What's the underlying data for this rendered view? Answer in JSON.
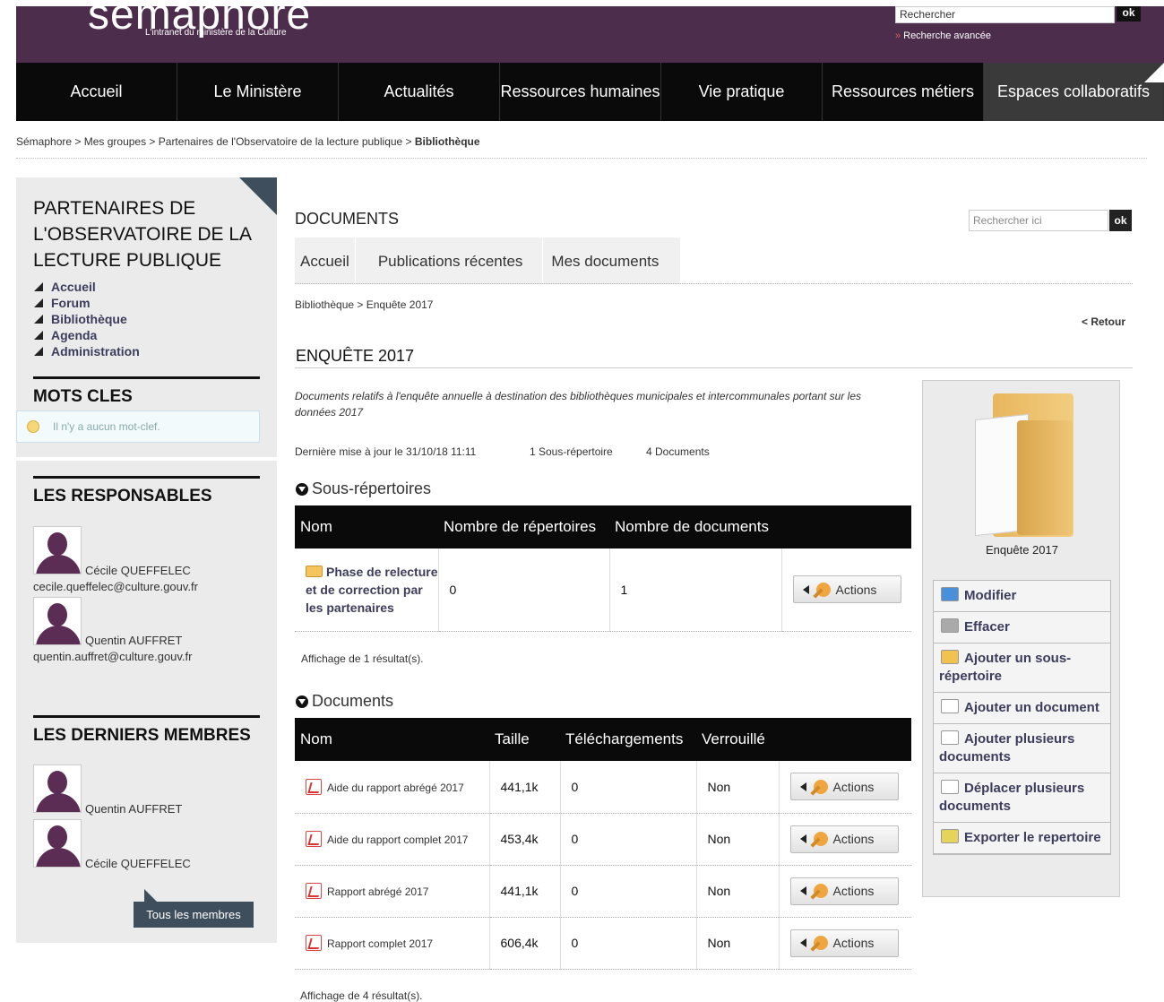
{
  "header": {
    "logo_word": "sémaphore",
    "logo_tagline": "L'intranet du ministère de la Culture",
    "search_placeholder": "Rechercher",
    "search_ok": "ok",
    "advanced_search": "Recherche avancée"
  },
  "nav": [
    {
      "label": "Accueil",
      "width": 180
    },
    {
      "label": "Le Ministère",
      "width": 180
    },
    {
      "label": "Actualités",
      "width": 180
    },
    {
      "label": "Ressources humaines",
      "width": 180
    },
    {
      "label": "Vie pratique",
      "width": 180
    },
    {
      "label": "Ressources métiers",
      "width": 180
    },
    {
      "label": "Espaces collaboratifs",
      "width": 201
    }
  ],
  "breadcrumb": {
    "trail": "Sémaphore > Mes groupes > Partenaires de l'Observatoire de la lecture publique > ",
    "current": "Bibliothèque"
  },
  "group": {
    "title": "PARTENAIRES DE L'OBSERVATOIRE DE LA LECTURE PUBLIQUE",
    "menu": [
      "Accueil",
      "Forum",
      "Bibliothèque",
      "Agenda",
      "Administration"
    ]
  },
  "keywords": {
    "heading": "MOTS CLES",
    "empty": "Il n'y a aucun mot-clef."
  },
  "responsables": {
    "heading": "LES RESPONSABLES",
    "people": [
      {
        "name": "Cécile QUEFFELEC",
        "email": "cecile.queffelec@culture.gouv.fr"
      },
      {
        "name": "Quentin AUFFRET",
        "email": "quentin.auffret@culture.gouv.fr"
      }
    ]
  },
  "members": {
    "heading": "LES DERNIERS MEMBRES",
    "people": [
      "Quentin AUFFRET",
      "Cécile QUEFFELEC"
    ],
    "all_button": "Tous les membres"
  },
  "documents": {
    "heading": "DOCUMENTS",
    "search_placeholder": "Rechercher ici",
    "search_ok": "ok",
    "tabs": [
      "Accueil",
      "Publications récentes",
      "Mes documents"
    ],
    "sub_breadcrumb_trail": "Bibliothèque > ",
    "sub_breadcrumb_current": "Enquête 2017",
    "back": "< Retour"
  },
  "folder": {
    "title": "ENQUÊTE 2017",
    "description": "Documents relatifs à l'enquête annuelle à destination des bibliothèques municipales et intercommunales portant sur les données 2017",
    "last_update": "Dernière mise à jour le 31/10/18 11:11",
    "subfolder_count": "1 Sous-répertoire",
    "doc_count": "4 Documents"
  },
  "subfolders": {
    "heading": "Sous-répertoires",
    "columns": [
      "Nom",
      "Nombre de répertoires",
      "Nombre de documents",
      ""
    ],
    "rows": [
      {
        "name": "Phase de relecture et de correction par les partenaires",
        "dirs": "0",
        "docs": "1",
        "action": "Actions"
      }
    ],
    "result": "Affichage de 1 résultat(s)."
  },
  "files": {
    "heading": "Documents",
    "columns": [
      "Nom",
      "Taille",
      "Téléchargements",
      "Verrouillé",
      ""
    ],
    "rows": [
      {
        "name": "Aide du rapport abrégé 2017",
        "size": "441,1k",
        "downloads": "0",
        "locked": "Non",
        "action": "Actions"
      },
      {
        "name": "Aide du rapport complet 2017",
        "size": "453,4k",
        "downloads": "0",
        "locked": "Non",
        "action": "Actions"
      },
      {
        "name": "Rapport abrégé 2017",
        "size": "441,1k",
        "downloads": "0",
        "locked": "Non",
        "action": "Actions"
      },
      {
        "name": "Rapport complet 2017",
        "size": "606,4k",
        "downloads": "0",
        "locked": "Non",
        "action": "Actions"
      }
    ],
    "result": "Affichage de 4 résultat(s)."
  },
  "right_panel": {
    "caption": "Enquête 2017",
    "actions": [
      {
        "label": "Modifier",
        "icon": "edit-icon",
        "color": "#4a90d9"
      },
      {
        "label": "Effacer",
        "icon": "trash-icon",
        "color": "#aaaaaa"
      },
      {
        "label": "Ajouter un sous-répertoire",
        "icon": "add-folder-icon",
        "color": "#f2c14e"
      },
      {
        "label": "Ajouter un document",
        "icon": "add-document-icon",
        "color": "#ffffff"
      },
      {
        "label": "Ajouter plusieurs documents",
        "icon": "add-documents-icon",
        "color": "#ffffff"
      },
      {
        "label": "Déplacer plusieurs documents",
        "icon": "move-documents-icon",
        "color": "#ffffff"
      },
      {
        "label": "Exporter le repertoire",
        "icon": "export-icon",
        "color": "#e6d35a"
      }
    ]
  }
}
